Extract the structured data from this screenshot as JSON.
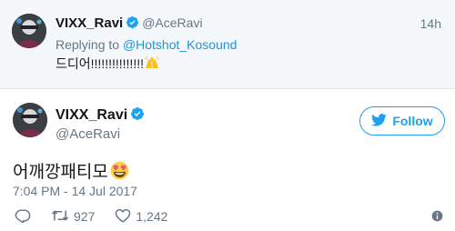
{
  "reply_tweet": {
    "name": "VIXX_Ravi",
    "handle": "@AceRavi",
    "time": "14h",
    "replying_prefix": "Replying to",
    "replying_to": "@Hotshot_Kosound",
    "text": "드디어!!!!!!!!!!!!!!!",
    "emoji": "raised-hands"
  },
  "main_tweet": {
    "name": "VIXX_Ravi",
    "handle": "@AceRavi",
    "follow_label": "Follow",
    "text": "어깨깡패티모",
    "emoji": "heart-eyes",
    "timestamp": "7:04 PM - 14 Jul 2017",
    "retweets": "927",
    "likes": "1,242"
  },
  "colors": {
    "accent": "#1da1f2",
    "muted": "#657786",
    "reply_bg": "#f5f8fa"
  }
}
